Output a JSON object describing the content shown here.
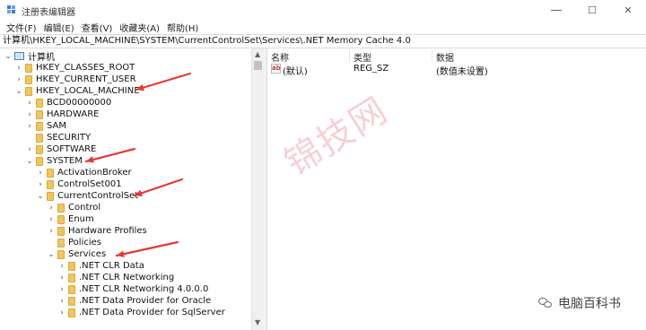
{
  "window": {
    "title": "注册表编辑器",
    "minimize_glyph": "—",
    "maximize_glyph": "☐",
    "close_glyph": "✕"
  },
  "menu": [
    "文件(F)",
    "编辑(E)",
    "查看(V)",
    "收藏夹(A)",
    "帮助(H)"
  ],
  "address": "计算机\\HKEY_LOCAL_MACHINE\\SYSTEM\\CurrentControlSet\\Services\\.NET Memory Cache 4.0",
  "tree": [
    {
      "label": "计算机",
      "state": "expanded",
      "icon": "computer-icon"
    },
    {
      "label": "HKEY_CLASSES_ROOT",
      "state": "collapsed",
      "icon": "folder-icon"
    },
    {
      "label": "HKEY_CURRENT_USER",
      "state": "collapsed",
      "icon": "folder-icon"
    },
    {
      "label": "HKEY_LOCAL_MACHINE",
      "state": "expanded",
      "icon": "folder-icon"
    },
    {
      "label": "BCD00000000",
      "state": "collapsed",
      "icon": "folder-icon"
    },
    {
      "label": "HARDWARE",
      "state": "collapsed",
      "icon": "folder-icon"
    },
    {
      "label": "SAM",
      "state": "collapsed",
      "icon": "folder-icon"
    },
    {
      "label": "SECURITY",
      "state": "none",
      "icon": "folder-icon"
    },
    {
      "label": "SOFTWARE",
      "state": "collapsed",
      "icon": "folder-icon"
    },
    {
      "label": "SYSTEM",
      "state": "expanded",
      "icon": "folder-icon"
    },
    {
      "label": "ActivationBroker",
      "state": "collapsed",
      "icon": "folder-icon"
    },
    {
      "label": "ControlSet001",
      "state": "collapsed",
      "icon": "folder-icon"
    },
    {
      "label": "CurrentControlSet",
      "state": "expanded",
      "icon": "folder-icon"
    },
    {
      "label": "Control",
      "state": "collapsed",
      "icon": "folder-icon"
    },
    {
      "label": "Enum",
      "state": "collapsed",
      "icon": "folder-icon"
    },
    {
      "label": "Hardware Profiles",
      "state": "collapsed",
      "icon": "folder-icon"
    },
    {
      "label": "Policies",
      "state": "none",
      "icon": "folder-icon"
    },
    {
      "label": "Services",
      "state": "expanded",
      "icon": "folder-icon"
    },
    {
      "label": ".NET CLR Data",
      "state": "collapsed",
      "icon": "folder-icon"
    },
    {
      "label": ".NET CLR Networking",
      "state": "collapsed",
      "icon": "folder-icon"
    },
    {
      "label": ".NET CLR Networking 4.0.0.0",
      "state": "collapsed",
      "icon": "folder-icon"
    },
    {
      "label": ".NET Data Provider for Oracle",
      "state": "collapsed",
      "icon": "folder-icon"
    },
    {
      "label": ".NET Data Provider for SqlServer",
      "state": "collapsed",
      "icon": "folder-icon"
    }
  ],
  "columns": {
    "name": "名称",
    "type": "类型",
    "data": "数据"
  },
  "values": [
    {
      "name": "(默认)",
      "type": "REG_SZ",
      "data": "(数值未设置)",
      "icon": "string-value-icon",
      "icon_text": "ab"
    }
  ],
  "watermark": "锦技网",
  "wechat_label": "电脑百科书",
  "colors": {
    "annotation_arrow": "#e53935",
    "folder": "#f2c55c"
  }
}
